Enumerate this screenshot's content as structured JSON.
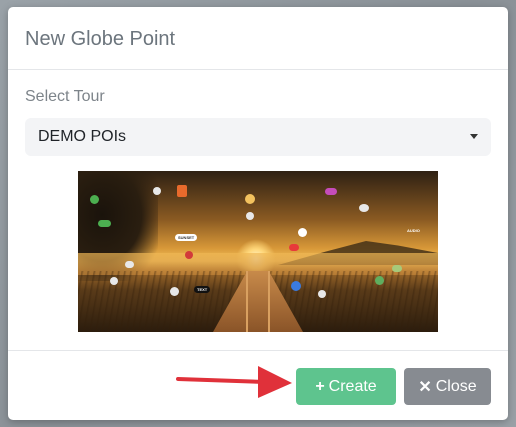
{
  "dialog": {
    "title": "New Globe Point"
  },
  "tour_field": {
    "label": "Select Tour",
    "selected": "DEMO POIs"
  },
  "preview": {
    "poi_labels": {
      "sunset": "SUNSET",
      "audio": "AUDIO",
      "text": "TEXT"
    }
  },
  "footer": {
    "create_label": "Create",
    "close_label": "Close",
    "create_icon": "plus-icon",
    "close_icon": "times-icon"
  },
  "colors": {
    "create": "#5ec48e",
    "close": "#878b91",
    "arrow": "#e0313a"
  }
}
